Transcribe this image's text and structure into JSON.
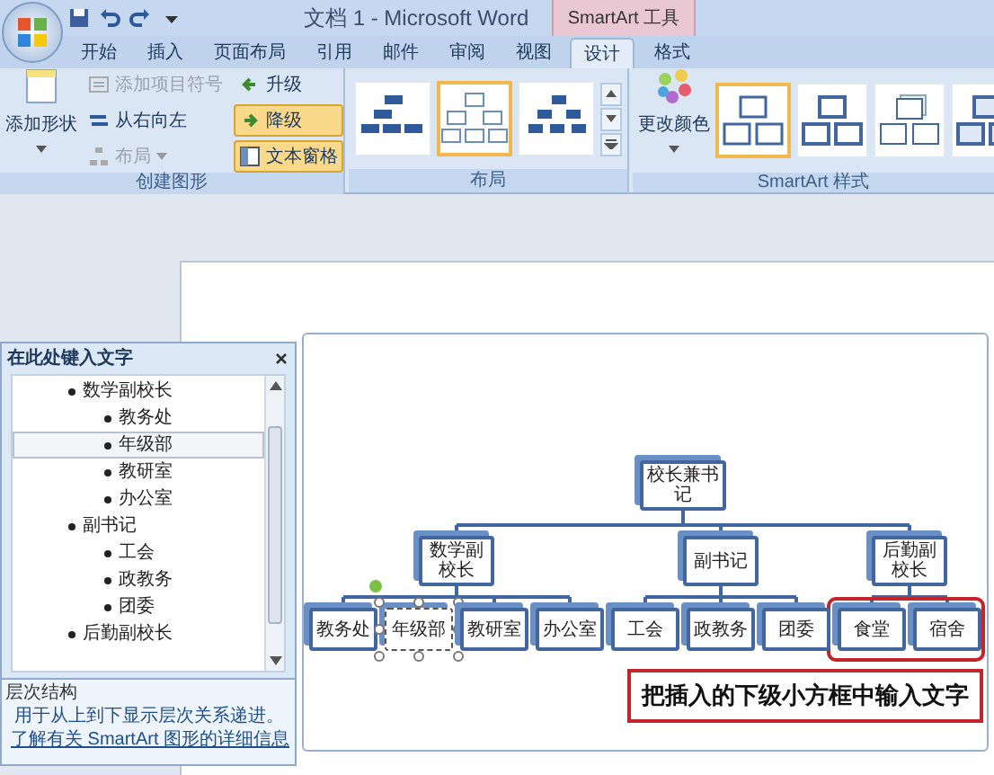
{
  "title_bar": {
    "title": "文档 1 - Microsoft Word",
    "contextual_header": "SmartArt 工具"
  },
  "tabs": [
    {
      "label": "开始",
      "selected": false
    },
    {
      "label": "插入",
      "selected": false
    },
    {
      "label": "页面布局",
      "selected": false
    },
    {
      "label": "引用",
      "selected": false
    },
    {
      "label": "邮件",
      "selected": false
    },
    {
      "label": "审阅",
      "selected": false
    },
    {
      "label": "视图",
      "selected": false
    },
    {
      "label": "设计",
      "selected": true
    },
    {
      "label": "格式",
      "selected": false
    }
  ],
  "ribbon_groups": [
    {
      "kind": "create",
      "label": "创建图形",
      "big_button": "添加形状",
      "buttons": [
        {
          "kind": "bullet",
          "label": "添加项目符号",
          "disabled": true,
          "pressed": false
        },
        {
          "kind": "rtl",
          "label": "从右向左",
          "disabled": false,
          "pressed": false
        },
        {
          "kind": "layout",
          "label": "布局",
          "disabled": true,
          "pressed": false
        },
        {
          "kind": "promote",
          "label": "升级",
          "disabled": false,
          "pressed": false
        },
        {
          "kind": "demote",
          "label": "降级",
          "disabled": false,
          "pressed": true
        },
        {
          "kind": "pane",
          "label": "文本窗格",
          "disabled": false,
          "pressed": true
        }
      ]
    },
    {
      "kind": "layouts",
      "label": "布局",
      "items": [
        {
          "selected": false
        },
        {
          "selected": true
        },
        {
          "selected": false
        }
      ]
    },
    {
      "kind": "styles",
      "label": "SmartArt 样式",
      "big_button": "更改颜色",
      "items": [
        {
          "selected": true
        },
        {
          "selected": false
        },
        {
          "selected": false
        },
        {
          "selected": false
        }
      ]
    }
  ],
  "text_pane": {
    "title": "在此处键入文字",
    "items": [
      {
        "text": "数学副校长",
        "selected": false,
        "children": [
          {
            "text": "教务处",
            "selected": false
          },
          {
            "text": "年级部",
            "selected": true
          },
          {
            "text": "教研室",
            "selected": false
          },
          {
            "text": "办公室",
            "selected": false
          }
        ]
      },
      {
        "text": "副书记",
        "selected": false,
        "children": [
          {
            "text": "工会",
            "selected": false
          },
          {
            "text": "政教务",
            "selected": false
          },
          {
            "text": "团委",
            "selected": false
          }
        ]
      },
      {
        "text": "后勤副校长",
        "selected": false
      }
    ],
    "footer": {
      "heading": "层次结构",
      "description": "用于从上到下显示层次关系递进。",
      "link": "了解有关 SmartArt 图形的详细信息"
    }
  },
  "diagram": {
    "root": {
      "text": "校长兼书记",
      "selected": false,
      "children": [
        {
          "text": "数学副校长",
          "selected": false,
          "children": [
            {
              "text": "教务处",
              "selected": false
            },
            {
              "text": "年级部",
              "selected": true
            },
            {
              "text": "教研室",
              "selected": false
            },
            {
              "text": "办公室",
              "selected": false
            }
          ]
        },
        {
          "text": "副书记",
          "selected": false,
          "children": [
            {
              "text": "工会",
              "selected": false
            },
            {
              "text": "政教务",
              "selected": false
            },
            {
              "text": "团委",
              "selected": false
            }
          ]
        },
        {
          "text": "后勤副校长",
          "selected": false,
          "children": [
            {
              "text": "食堂",
              "selected": false
            },
            {
              "text": "宿舍",
              "selected": false
            }
          ]
        }
      ]
    }
  },
  "callout": {
    "text": "把插入的下级小方框中输入文字"
  }
}
